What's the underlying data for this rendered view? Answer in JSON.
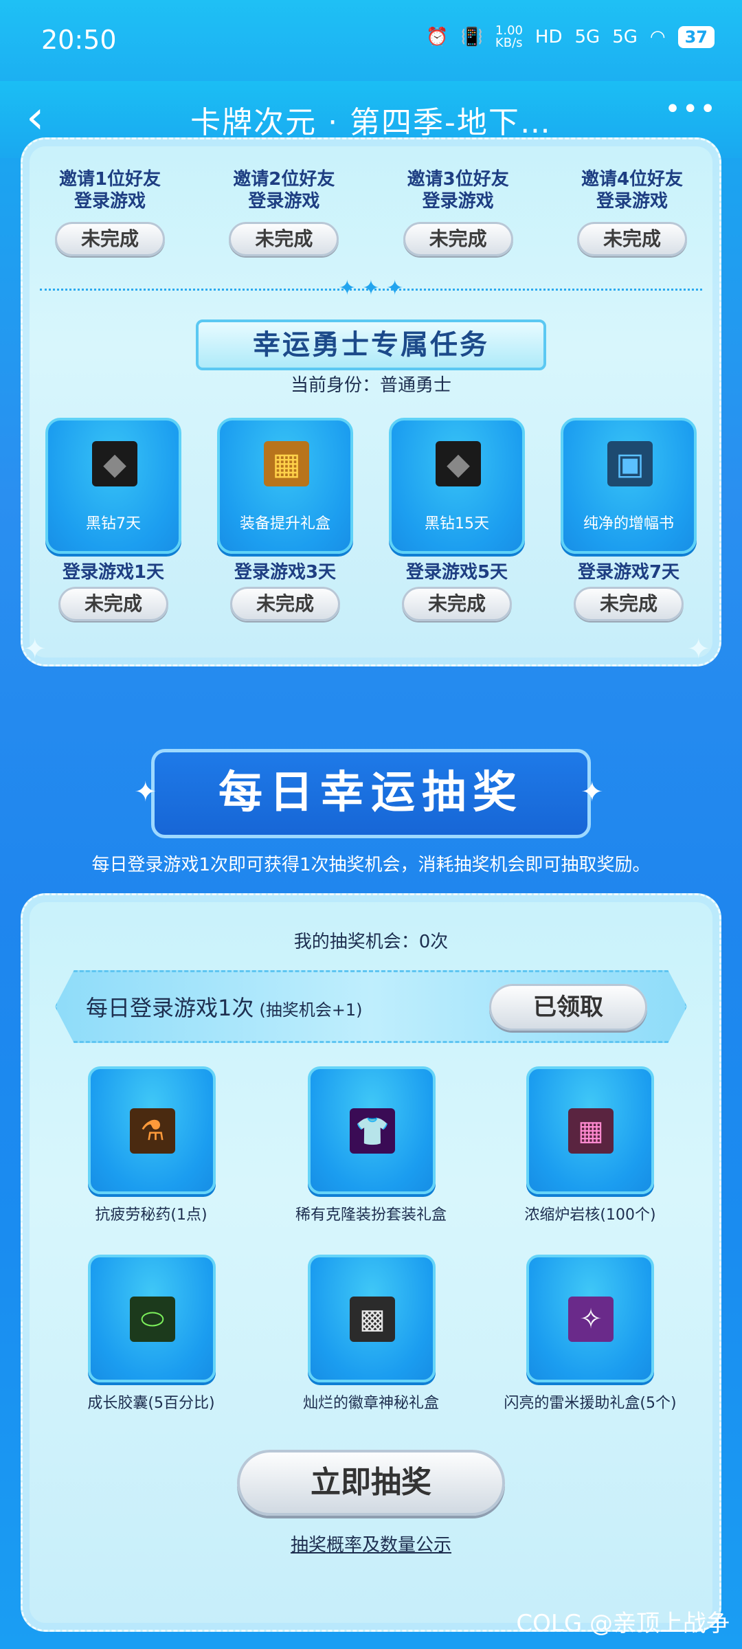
{
  "status_bar": {
    "time": "20:50",
    "speed": "1.00 KB/s",
    "signal1": "5G",
    "signal2": "5G",
    "battery": "37"
  },
  "nav": {
    "back_icon": "chevron-left-icon",
    "title": "卡牌次元 · 第四季-地下…",
    "more_icon": "more-dots-icon"
  },
  "invite": {
    "items": [
      {
        "label_line1": "邀请1位好友",
        "label_line2": "登录游戏",
        "status": "未完成"
      },
      {
        "label_line1": "邀请2位好友",
        "label_line2": "登录游戏",
        "status": "未完成"
      },
      {
        "label_line1": "邀请3位好友",
        "label_line2": "登录游戏",
        "status": "未完成"
      },
      {
        "label_line1": "邀请4位好友",
        "label_line2": "登录游戏",
        "status": "未完成"
      }
    ]
  },
  "lucky_tasks": {
    "banner": "幸运勇士专属任务",
    "identity": "当前身份：普通勇士",
    "rewards": [
      {
        "name": "黑钻7天",
        "task": "登录游戏1天",
        "status": "未完成",
        "icon": "black-diamond-icon"
      },
      {
        "name": "装备提升礼盒",
        "task": "登录游戏3天",
        "status": "未完成",
        "icon": "treasure-chest-icon"
      },
      {
        "name": "黑钻15天",
        "task": "登录游戏5天",
        "status": "未完成",
        "icon": "black-diamond-icon"
      },
      {
        "name": "纯净的增幅书",
        "task": "登录游戏7天",
        "status": "未完成",
        "icon": "blue-book-icon"
      }
    ]
  },
  "daily": {
    "banner": "每日幸运抽奖",
    "description": "每日登录游戏1次即可获得1次抽奖机会，消耗抽奖机会即可抽取奖励。",
    "chances": "我的抽奖机会：0次",
    "claim_text": "每日登录游戏1次",
    "claim_note": "(抽奖机会+1)",
    "claim_button": "已领取",
    "prizes": [
      {
        "name": "抗疲劳秘药(1点)",
        "icon": "potion-bottle-icon"
      },
      {
        "name": "稀有克隆装扮套装礼盒",
        "icon": "purple-outfit-icon"
      },
      {
        "name": "浓缩炉岩核(100个)",
        "icon": "pink-chest-icon"
      },
      {
        "name": "成长胶囊(5百分比)",
        "icon": "exp-capsule-icon"
      },
      {
        "name": "灿烂的徽章神秘礼盒",
        "icon": "emblem-box-icon"
      },
      {
        "name": "闪亮的雷米援助礼盒(5个)",
        "icon": "sparkle-box-icon"
      }
    ],
    "draw_button": "立即抽奖",
    "rules_link": "抽奖概率及数量公示"
  },
  "watermark": "COLG @亲顶上战争",
  "colors": {
    "accent": "#1aa6f0",
    "panel": "#d8f6fc",
    "banner_blue": "#1766d6"
  }
}
